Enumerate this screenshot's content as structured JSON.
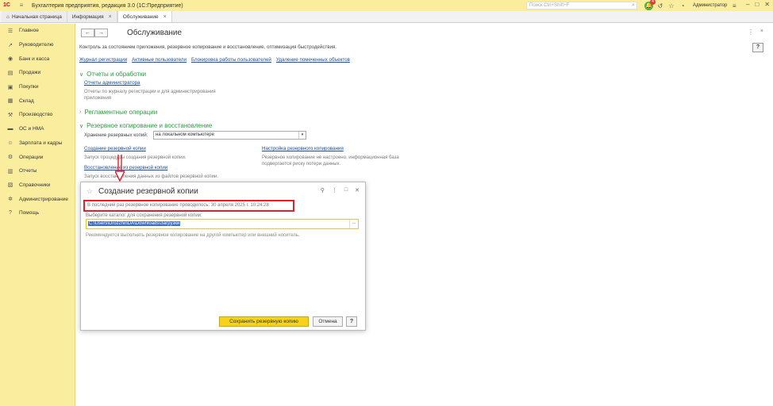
{
  "app": {
    "title": "Бухгалтерия предприятия, редакция 3.0  (1С:Предприятие)",
    "logo": "1С",
    "search_placeholder": "Поиск Ctrl+Shift+F",
    "notifications_count": "4",
    "user": "Администратор"
  },
  "tabs": [
    {
      "label": "Начальная страница"
    },
    {
      "label": "Информация"
    },
    {
      "label": "Обслуживание"
    }
  ],
  "sidebar": {
    "items": [
      {
        "label": "Главное",
        "icon": "menu-icon"
      },
      {
        "label": "Руководителю",
        "icon": "chart-line-icon"
      },
      {
        "label": "Банк и касса",
        "icon": "bank-icon"
      },
      {
        "label": "Продажи",
        "icon": "cart-icon"
      },
      {
        "label": "Покупки",
        "icon": "basket-icon"
      },
      {
        "label": "Склад",
        "icon": "warehouse-icon"
      },
      {
        "label": "Производство",
        "icon": "factory-icon"
      },
      {
        "label": "ОС и НМА",
        "icon": "car-icon"
      },
      {
        "label": "Зарплата и кадры",
        "icon": "people-icon"
      },
      {
        "label": "Операции",
        "icon": "operations-icon"
      },
      {
        "label": "Отчеты",
        "icon": "report-icon"
      },
      {
        "label": "Справочники",
        "icon": "book-icon"
      },
      {
        "label": "Администрирование",
        "icon": "gear-icon"
      },
      {
        "label": "Помощь",
        "icon": "help-icon"
      }
    ]
  },
  "main": {
    "title": "Обслуживание",
    "description": "Контроль за состоянием приложения, резервное копирование и восстановление, оптимизация быстродействия.",
    "links": [
      "Журнал регистрации",
      "Активные пользователи",
      "Блокировка работы пользователей",
      "Удаление помеченных объектов"
    ],
    "section_reports": "Отчеты и обработки",
    "admin_reports_link": "Отчеты администратора",
    "admin_reports_desc": "Отчеты по журналу регистрации и для администрирования приложения",
    "section_routine": "Регламентные операции",
    "section_backup": "Резервное копирование и восстановление",
    "storage_label": "Хранение резервных копий:",
    "storage_value": "на локальном компьютере",
    "create_backup_link": "Создание резервной копии",
    "create_backup_desc": "Запуск процедуры создания резервной копии.",
    "backup_settings_link": "Настройка резервного копирования",
    "backup_settings_desc": "Резервное копирование не настроено, информационная база подвергается риску потери данных.",
    "restore_link": "Восстановление из резервной копии",
    "restore_desc": "Запуск восстановления данных из файлов резервной копии."
  },
  "dialog": {
    "title": "Создание резервной копии",
    "last_backup": "В последний раз резервное копирование проводилось: 30 апреля 2025 г. 10:24:28",
    "folder_label": "Выберите каталог для сохранения резервной копии:",
    "folder_path": "C:\\Users\\DrozzhinDA\\Downloads\\Загрузки",
    "folder_btn": "...",
    "note": "Рекомендуется выполнять резервное копирование на другой компьютер или внешний носитель.",
    "save_button": "Сохранить резервную копию",
    "cancel_button": "Отмена",
    "help_button": "?"
  },
  "colors": {
    "sidebar_bg": "#fbed9e",
    "section_green": "#2e9a43",
    "link_blue": "#1a4ea3",
    "highlight_red": "#e0202a",
    "primary_button": "#f5d31b"
  }
}
